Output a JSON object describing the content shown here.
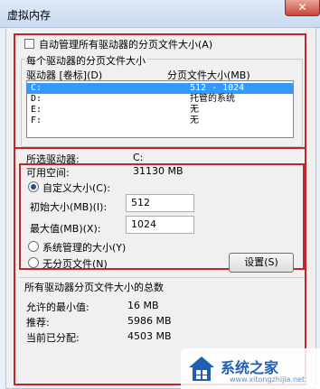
{
  "window": {
    "title": "虚拟内存",
    "close_glyph": "✕"
  },
  "auto_manage": {
    "label": "自动管理所有驱动器的分页文件大小(A)",
    "checked": false
  },
  "per_drive": {
    "section_label": "每个驱动器的分页文件大小",
    "col_drive": "驱动器 [卷标](D)",
    "col_size": "分页文件大小(MB)",
    "rows": [
      {
        "drive": "C:",
        "size": "512 - 1024",
        "selected": true
      },
      {
        "drive": "D:",
        "size": "托管的系统",
        "selected": false
      },
      {
        "drive": "E:",
        "size": "无",
        "selected": false
      },
      {
        "drive": "F:",
        "size": "无",
        "selected": false
      }
    ]
  },
  "selected_drive": {
    "label": "所选驱动器:",
    "value": "C:",
    "free_label": "可用空间:",
    "free_value": "31130 MB"
  },
  "options": {
    "custom_label": "自定义大小(C):",
    "initial_label": "初始大小(MB)(I):",
    "initial_value": "512",
    "max_label": "最大值(MB)(X):",
    "max_value": "1024",
    "system_managed_label": "系统管理的大小(Y)",
    "no_paging_label": "无分页文件(N)",
    "selected": "custom",
    "set_button": "设置(S)"
  },
  "totals": {
    "section_label": "所有驱动器分页文件大小的总数",
    "min_label": "允许的最小值:",
    "min_value": "16 MB",
    "recommended_label": "推荐:",
    "recommended_value": "5986 MB",
    "current_label": "当前已分配:",
    "current_value": "4503 MB"
  },
  "watermark": {
    "text": "系统之家",
    "url": "www.xitongzhijia.net"
  },
  "colors": {
    "highlight_red": "#c0272d",
    "selection_blue": "#3399ff"
  }
}
